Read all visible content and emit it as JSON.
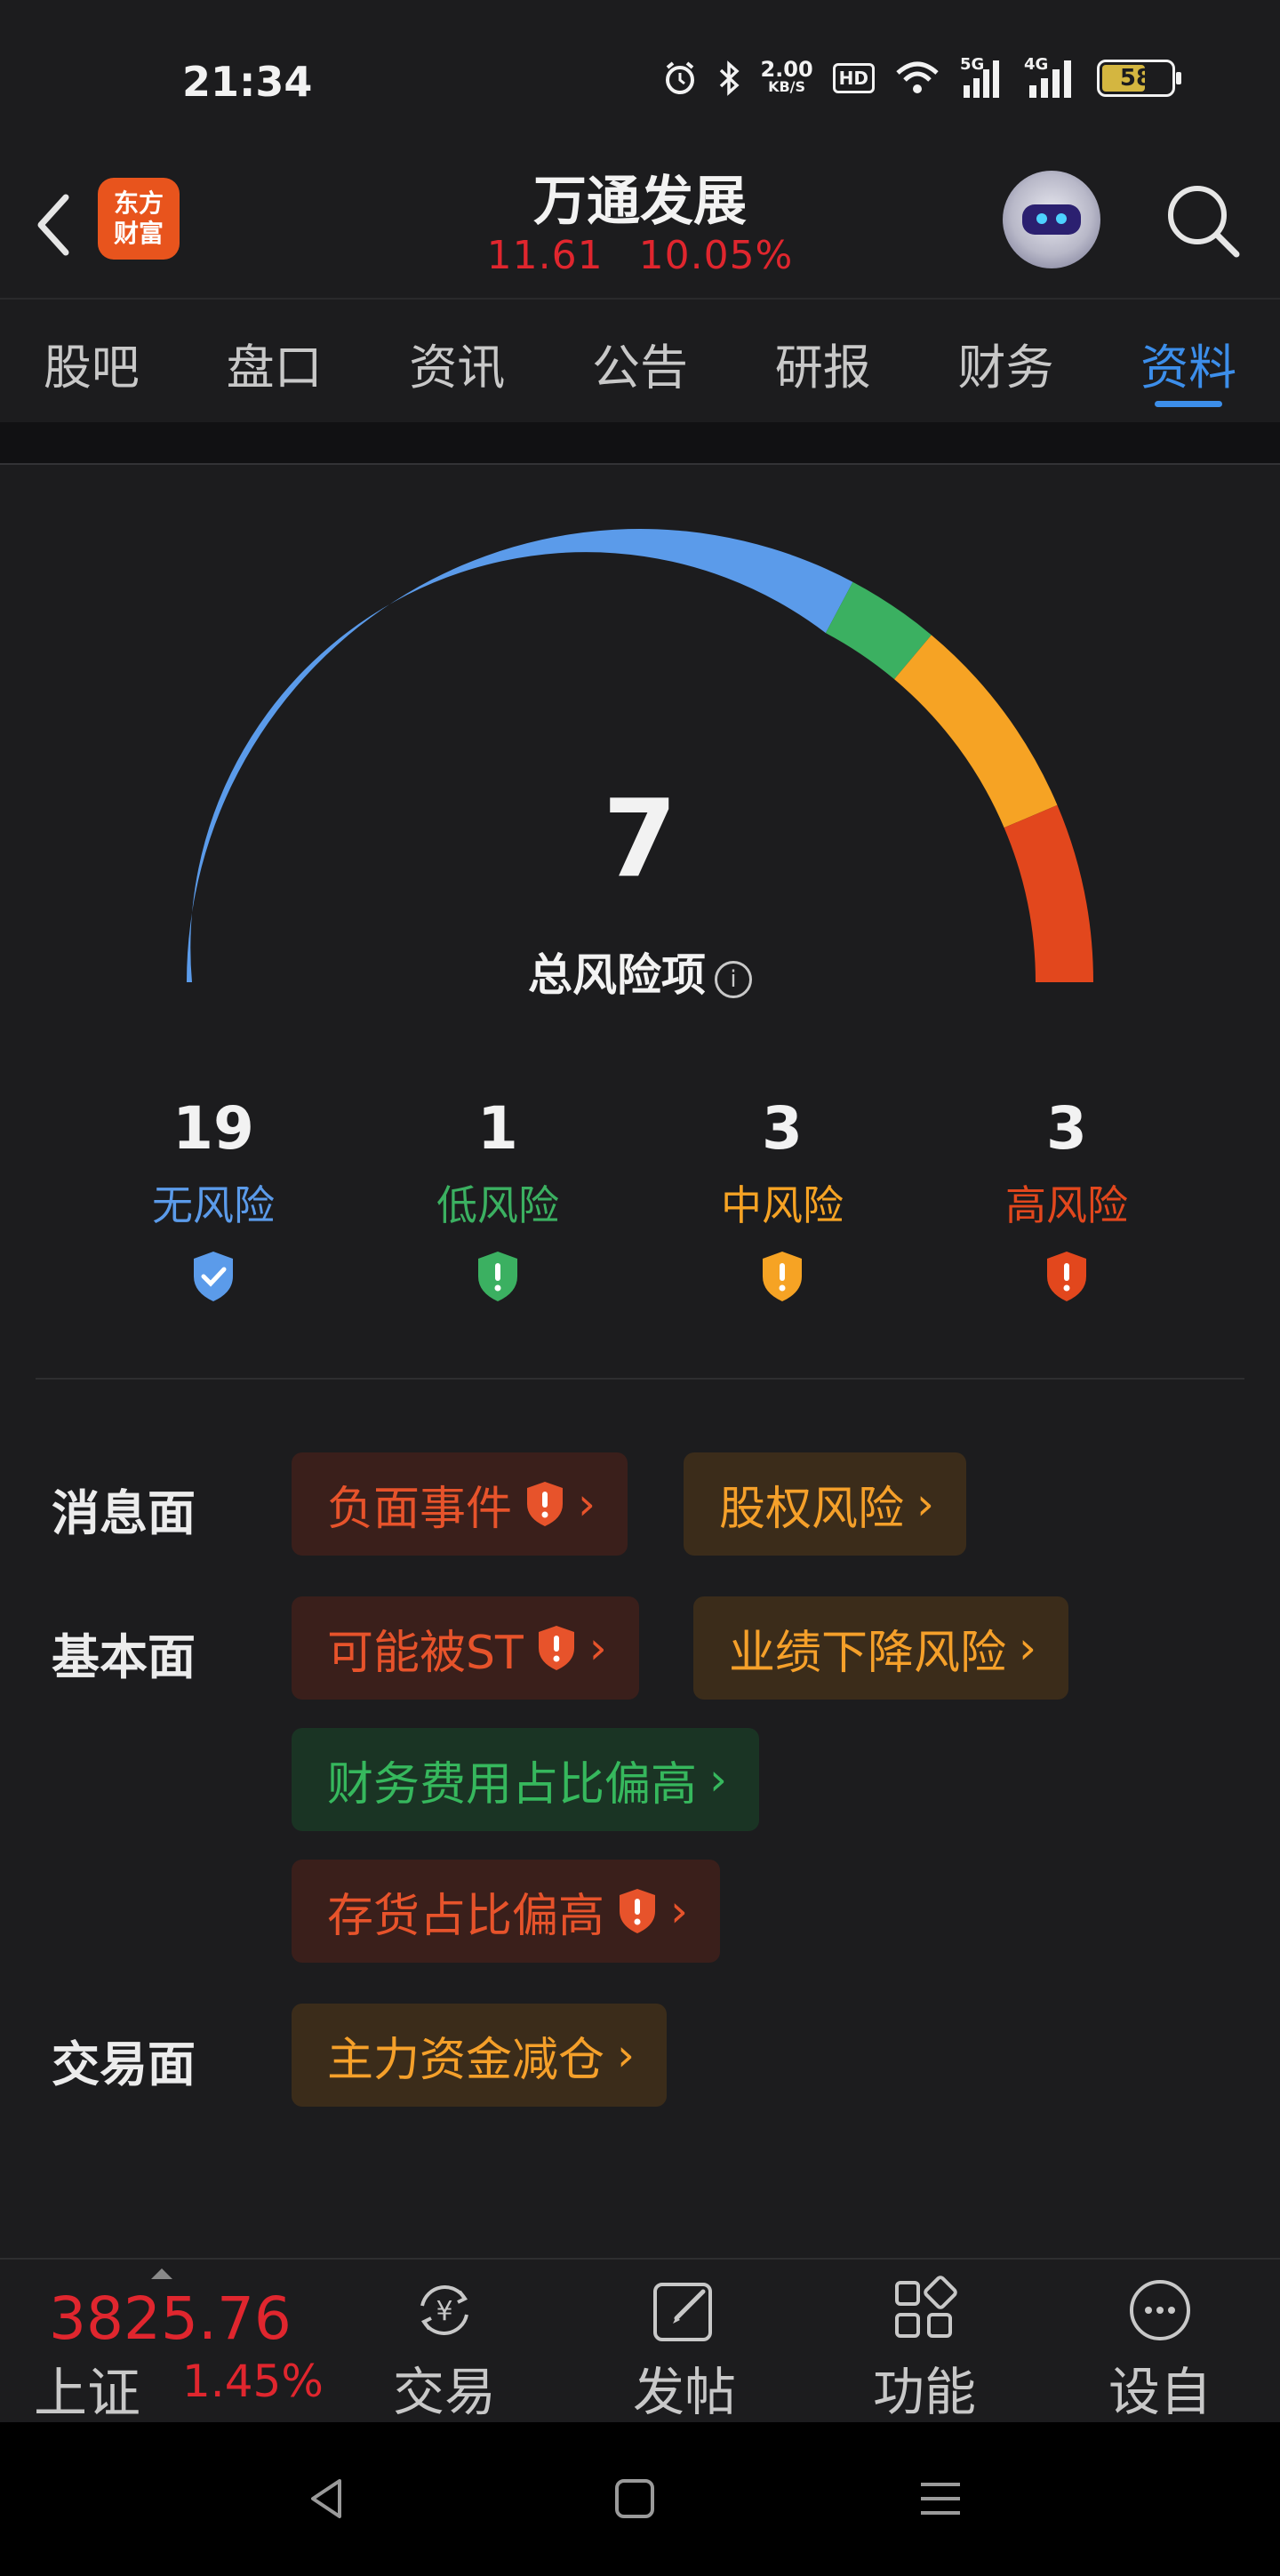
{
  "status_bar": {
    "time": "21:34",
    "net_speed_value": "2.00",
    "net_speed_unit": "KB/S",
    "hd_badge": "HD",
    "sim1": "5G",
    "sim2": "4G",
    "battery": "58"
  },
  "header": {
    "logo_line1": "东方",
    "logo_line2": "财富",
    "stock_name": "万通发展",
    "price": "11.61",
    "change_pct": "10.05%"
  },
  "tabs": [
    {
      "label": "股吧"
    },
    {
      "label": "盘口"
    },
    {
      "label": "资讯"
    },
    {
      "label": "公告"
    },
    {
      "label": "研报"
    },
    {
      "label": "财务"
    },
    {
      "label": "资料"
    }
  ],
  "active_tab": 6,
  "risk": {
    "total": "7",
    "total_label": "总风险项",
    "levels": [
      {
        "count": "19",
        "label": "无风险",
        "color": "#5b9bea"
      },
      {
        "count": "1",
        "label": "低风险",
        "color": "#3bb061"
      },
      {
        "count": "3",
        "label": "中风险",
        "color": "#f6a324"
      },
      {
        "count": "3",
        "label": "高风险",
        "color": "#e2471d"
      }
    ]
  },
  "categories": {
    "news": {
      "label": "消息面",
      "chips": [
        "负面事件",
        "股权风险"
      ]
    },
    "fundamentals": {
      "label": "基本面",
      "chips": [
        "可能被ST",
        "业绩下降风险",
        "财务费用占比偏高",
        "存货占比偏高"
      ]
    },
    "trading": {
      "label": "交易面",
      "chips": [
        "主力资金减仓"
      ]
    }
  },
  "bottom_bar": {
    "index_value": "3825.76",
    "index_name": "上证",
    "index_change": "1.45%",
    "nav": [
      {
        "label": "交易",
        "icon": "yuan-exchange-icon"
      },
      {
        "label": "发帖",
        "icon": "compose-icon"
      },
      {
        "label": "功能",
        "icon": "grid-icon"
      },
      {
        "label": "设自选",
        "icon": "more-icon"
      }
    ]
  }
}
